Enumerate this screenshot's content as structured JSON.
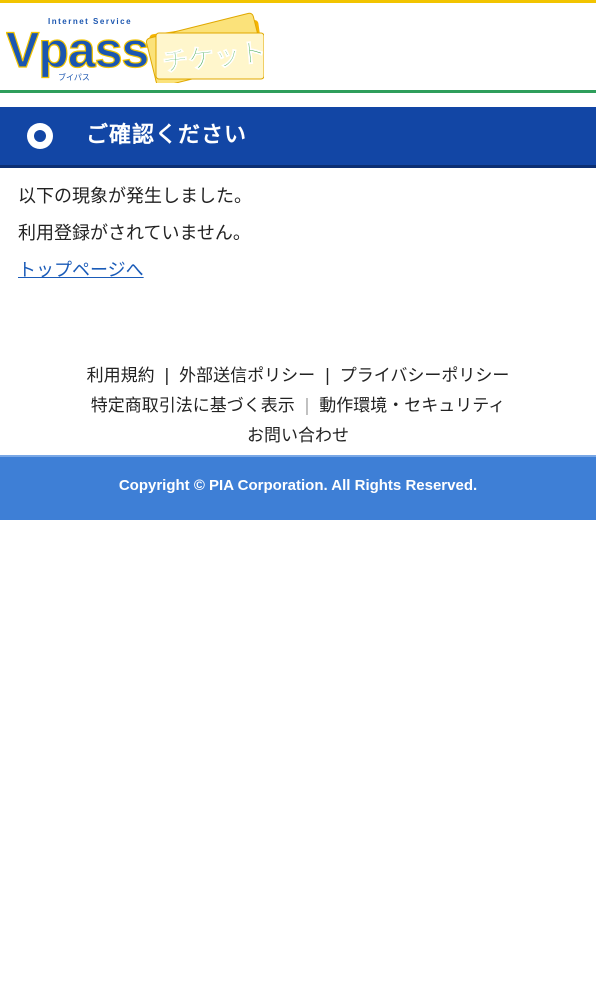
{
  "header": {
    "logo_main": "Vpass",
    "logo_sub_top": "Internet Service",
    "logo_sub_bottom": "ブイパス",
    "logo_ticket": "チケット"
  },
  "title_bar": {
    "title": "ご確認ください"
  },
  "content": {
    "message_line1": "以下の現象が発生しました。",
    "message_line2": "利用登録がされていません。",
    "top_page_link": "トップページへ"
  },
  "footer": {
    "terms": "利用規約",
    "sep1": "|",
    "external_policy": "外部送信ポリシー",
    "sep2": "|",
    "privacy_policy": "プライバシーポリシー",
    "commercial_law": "特定商取引法に基づく表示",
    "sep3": "|",
    "environment_security": "動作環境・セキュリティ",
    "contact": "お問い合わせ",
    "copyright": "Copyright © PIA Corporation. All Rights Reserved."
  },
  "colors": {
    "top_stripe": "#f2c400",
    "green_rule": "#2e9e5b",
    "title_bar": "#1246a5",
    "link": "#1a5bb8",
    "copyright_bar": "#3e7fd6"
  }
}
